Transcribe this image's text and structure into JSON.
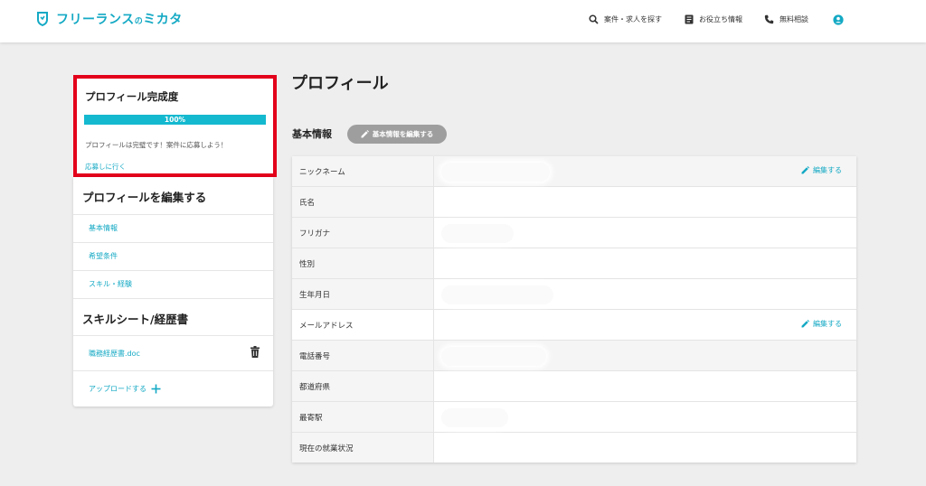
{
  "header": {
    "logo_text": "フリーランス",
    "logo_no": "の",
    "logo_text2": "ミカタ",
    "nav": [
      {
        "label": "案件・求人を探す",
        "icon": "search-icon"
      },
      {
        "label": "お役立ち情報",
        "icon": "article-icon"
      },
      {
        "label": "無料相談",
        "icon": "phone-icon"
      }
    ],
    "account_icon": "account-icon"
  },
  "completion": {
    "title": "プロフィール完成度",
    "percent_label": "100%",
    "percent": 100,
    "message": "プロフィールは完璧です！案件に応募しよう！",
    "link": "応募しに行く"
  },
  "edit_profile": {
    "title": "プロフィールを編集する",
    "links": [
      "基本情報",
      "希望条件",
      "スキル・経験"
    ]
  },
  "skill_sheet": {
    "title": "スキルシート/経歴書",
    "file": "職務経歴書.doc",
    "upload": "アップロードする"
  },
  "main": {
    "title": "プロフィール",
    "basic_label": "基本情報",
    "edit_basic_button": "基本情報を編集する",
    "row_edit_label": "編集する",
    "rows": [
      {
        "label": "ニックネーム"
      },
      {
        "label": "氏名"
      },
      {
        "label": "フリガナ"
      },
      {
        "label": "性別"
      },
      {
        "label": "生年月日"
      },
      {
        "label": "メールアドレス"
      },
      {
        "label": "電話番号"
      },
      {
        "label": "都道府県"
      },
      {
        "label": "最寄駅"
      },
      {
        "label": "現在の就業状況"
      }
    ]
  },
  "colors": {
    "accent": "#14a9c4",
    "highlight": "#e3001b",
    "progress": "#14b9cf"
  }
}
